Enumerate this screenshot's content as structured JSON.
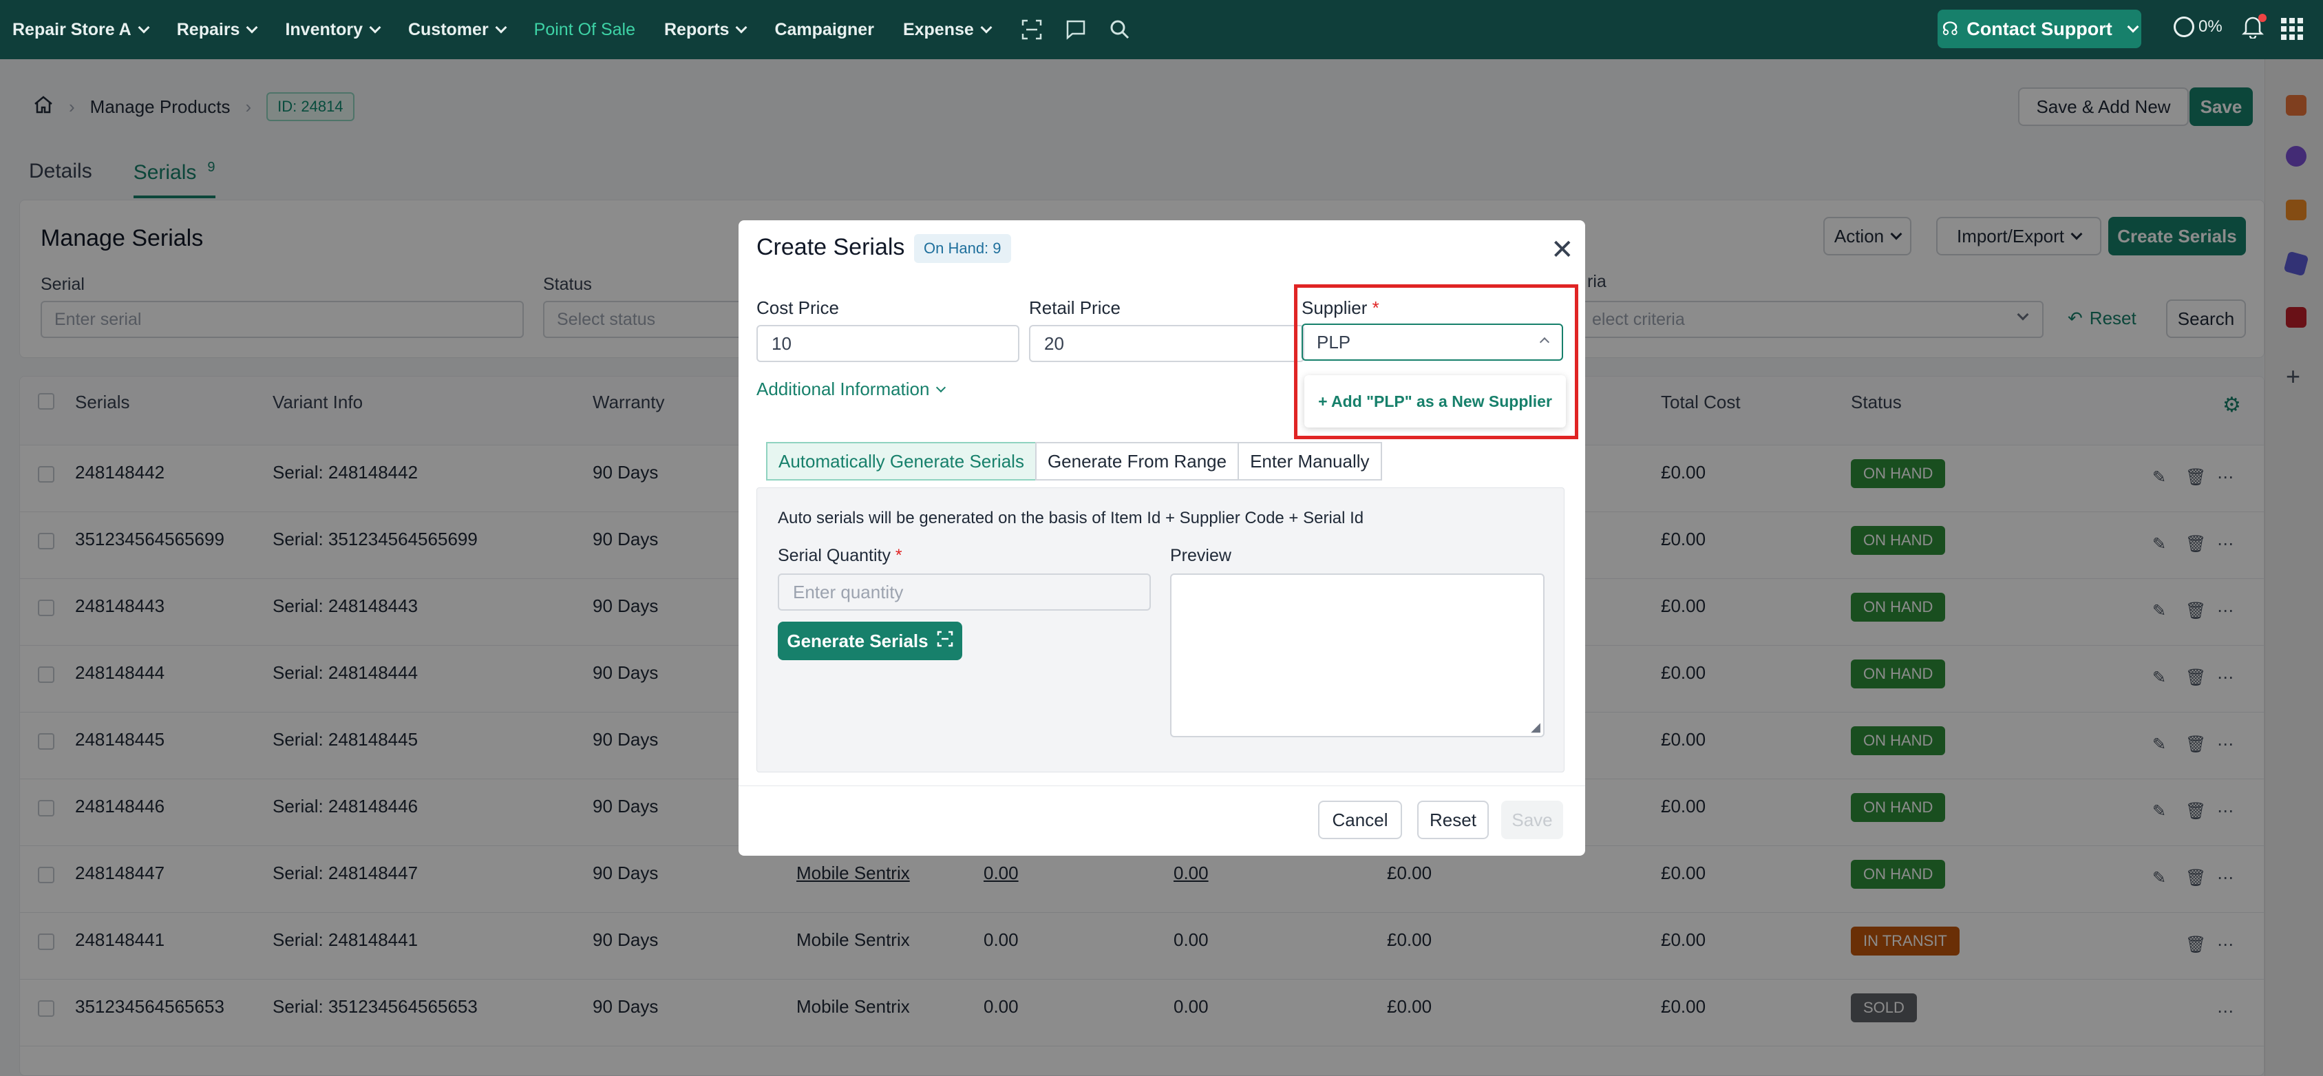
{
  "nav": {
    "items": [
      {
        "label": "Repair Store A",
        "chev": true
      },
      {
        "label": "Repairs",
        "chev": true
      },
      {
        "label": "Inventory",
        "chev": true
      },
      {
        "label": "Customer",
        "chev": true
      },
      {
        "label": "Point Of Sale",
        "chev": false,
        "active": true
      },
      {
        "label": "Reports",
        "chev": true
      },
      {
        "label": "Campaigner",
        "chev": false
      },
      {
        "label": "Expense",
        "chev": true
      }
    ],
    "support_label": "Contact Support",
    "progress": "0%"
  },
  "header": {
    "breadcrumb_page": "Manage Products",
    "id_badge": "ID: 24814",
    "save_add_new": "Save & Add New",
    "save": "Save"
  },
  "tabs": {
    "details": "Details",
    "serials": "Serials",
    "serials_count": "9"
  },
  "filters": {
    "title": "Manage Serials",
    "serial_label": "Serial",
    "serial_placeholder": "Enter serial",
    "status_label": "Status",
    "status_placeholder": "Select status",
    "criteria_label_fragment": "ria",
    "criteria_placeholder_fragment": "elect criteria",
    "action": "Action",
    "import_export": "Import/Export",
    "create_serials": "Create Serials",
    "reset": "Reset",
    "search": "Search"
  },
  "table": {
    "headers": {
      "serials": "Serials",
      "variant": "Variant Info",
      "warranty": "Warranty",
      "total_cost": "Total Cost",
      "status": "Status"
    },
    "rows": [
      {
        "serial": "248148442",
        "variant": "Serial: 248148442",
        "warranty": "90 Days",
        "supplier": "",
        "c1": "",
        "c2": "",
        "total": "£0.00",
        "cost": "£0.00",
        "status": "ON HAND",
        "status_color": "#2f8f3a",
        "edit": true
      },
      {
        "serial": "351234564565699",
        "variant": "Serial: 351234564565699",
        "warranty": "90 Days",
        "supplier": "",
        "c1": "",
        "c2": "",
        "total": "£0.00",
        "cost": "£0.00",
        "status": "ON HAND",
        "status_color": "#2f8f3a",
        "edit": true
      },
      {
        "serial": "248148443",
        "variant": "Serial: 248148443",
        "warranty": "90 Days",
        "supplier": "",
        "c1": "",
        "c2": "",
        "total": "£0.00",
        "cost": "£0.00",
        "status": "ON HAND",
        "status_color": "#2f8f3a",
        "edit": true
      },
      {
        "serial": "248148444",
        "variant": "Serial: 248148444",
        "warranty": "90 Days",
        "supplier": "",
        "c1": "",
        "c2": "",
        "total": "£0.00",
        "cost": "£0.00",
        "status": "ON HAND",
        "status_color": "#2f8f3a",
        "edit": true
      },
      {
        "serial": "248148445",
        "variant": "Serial: 248148445",
        "warranty": "90 Days",
        "supplier": "",
        "c1": "",
        "c2": "",
        "total": "£0.00",
        "cost": "£0.00",
        "status": "ON HAND",
        "status_color": "#2f8f3a",
        "edit": true
      },
      {
        "serial": "248148446",
        "variant": "Serial: 248148446",
        "warranty": "90 Days",
        "supplier": "",
        "c1": "",
        "c2": "",
        "total": "£0.00",
        "cost": "£0.00",
        "status": "ON HAND",
        "status_color": "#2f8f3a",
        "edit": true
      },
      {
        "serial": "248148447",
        "variant": "Serial: 248148447",
        "warranty": "90 Days",
        "supplier": "Mobile Sentrix",
        "c1": "0.00",
        "c2": "0.00",
        "total": "£0.00",
        "cost": "£0.00",
        "status": "ON HAND",
        "status_color": "#2f8f3a",
        "edit": true,
        "underline": true
      },
      {
        "serial": "248148441",
        "variant": "Serial: 248148441",
        "warranty": "90 Days",
        "supplier": "Mobile Sentrix",
        "c1": "0.00",
        "c2": "0.00",
        "total": "£0.00",
        "cost": "£0.00",
        "status": "IN TRANSIT",
        "status_color": "#c2570c",
        "edit": false
      },
      {
        "serial": "351234564565653",
        "variant": "Serial: 351234564565653",
        "warranty": "90 Days",
        "supplier": "Mobile Sentrix",
        "c1": "0.00",
        "c2": "0.00",
        "total": "£0.00",
        "cost": "£0.00",
        "status": "SOLD",
        "status_color": "#5f6368",
        "edit": false,
        "no_delete": true
      }
    ]
  },
  "modal": {
    "title": "Create Serials",
    "on_hand": "On Hand: 9",
    "cost_label": "Cost Price",
    "cost_value": "10",
    "retail_label": "Retail Price",
    "retail_value": "20",
    "supplier_label": "Supplier",
    "supplier_value": "PLP",
    "required_mark": "*",
    "additional_info": "Additional Information",
    "tab_auto": "Automatically Generate Serials",
    "tab_range": "Generate From Range",
    "tab_manual": "Enter Manually",
    "description": "Auto serials will be generated on the basis of Item Id + Supplier Code + Serial Id",
    "qty_label": "Serial Quantity",
    "qty_placeholder": "Enter quantity",
    "preview_label": "Preview",
    "generate": "Generate Serials",
    "cancel": "Cancel",
    "reset": "Reset",
    "save": "Save",
    "dropdown_add": "+ Add \"PLP\" as a New Supplier"
  },
  "colors": {
    "brand": "#17806b",
    "topbar": "#0f3e3a",
    "highlight": "#e02424"
  }
}
